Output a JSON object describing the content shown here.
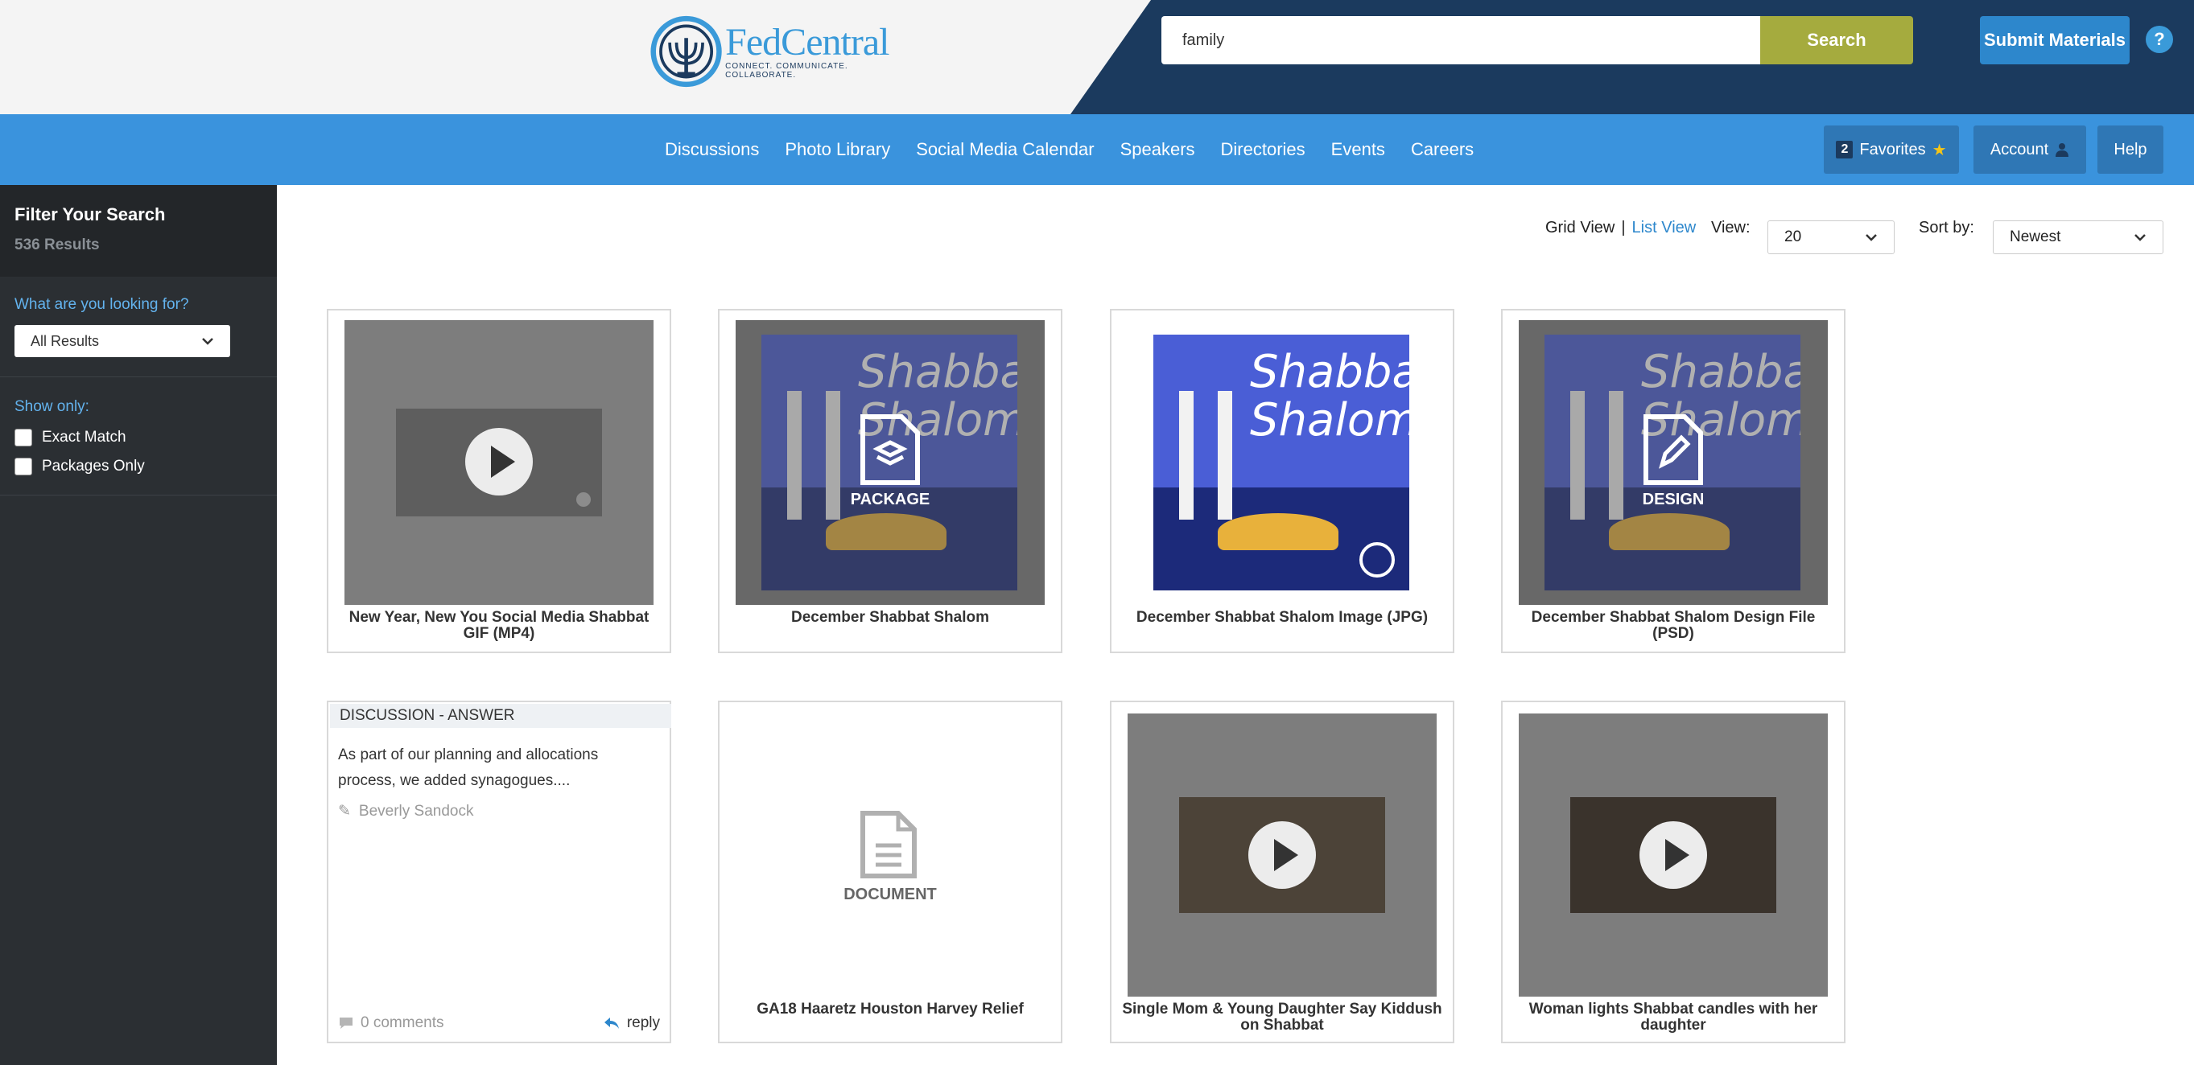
{
  "header": {
    "logo_title": "FedCentral",
    "logo_tagline": "CONNECT. COMMUNICATE. COLLABORATE.",
    "search_value": "family",
    "search_button": "Search",
    "submit_button": "Submit Materials",
    "help_glyph": "?"
  },
  "nav": {
    "links": [
      "Discussions",
      "Photo Library",
      "Social Media Calendar",
      "Speakers",
      "Directories",
      "Events",
      "Careers"
    ],
    "favorites_count": "2",
    "favorites_label": "Favorites",
    "account_label": "Account",
    "help_label": "Help"
  },
  "sidebar": {
    "title": "Filter Your Search",
    "results": "536 Results",
    "looking_for_label": "What are you looking for?",
    "looking_for_value": "All Results",
    "show_only_label": "Show only:",
    "exact_match": "Exact Match",
    "packages_only": "Packages Only"
  },
  "toolbar": {
    "grid_view": "Grid View",
    "separator": "|",
    "list_view": "List View",
    "view_label": "View:",
    "view_value": "20",
    "sort_label": "Sort by:",
    "sort_value": "Newest"
  },
  "cards": [
    {
      "title": "New Year, New You Social Media Shabbat GIF (MP4)"
    },
    {
      "title": "December Shabbat Shalom",
      "overlay": "PACKAGE"
    },
    {
      "title": "December Shabbat Shalom Image (JPG)"
    },
    {
      "title": "December Shabbat Shalom Design File (PSD)",
      "overlay": "DESIGN"
    },
    {
      "type_label": "DISCUSSION - ANSWER",
      "body": "As part of our planning and allocations process, we added synagogues....",
      "author": "Beverly Sandock",
      "comments": "0 comments",
      "reply": "reply"
    },
    {
      "title": "GA18 Haaretz Houston Harvey Relief",
      "doc_label": "DOCUMENT"
    },
    {
      "title": "Single Mom & Young Daughter Say Kiddush on Shabbat"
    },
    {
      "title": "Woman lights Shabbat candles with her daughter"
    }
  ],
  "art_words": [
    "Shabbat",
    "Shalom"
  ],
  "colors": {
    "navbar": "#3a93dd",
    "header_dark": "#1b3a5e",
    "search_button": "#a5ab3e",
    "submit_button": "#2d87cc",
    "sidebar": "#2b2f33"
  }
}
